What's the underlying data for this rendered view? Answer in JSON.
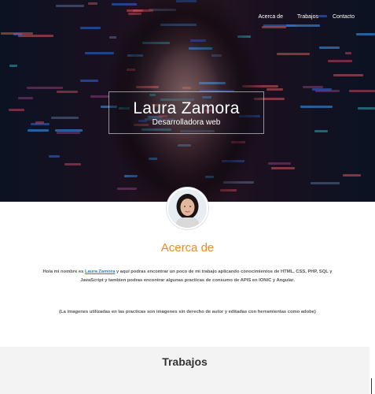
{
  "nav": {
    "items": [
      {
        "label": "Acerca de"
      },
      {
        "label": "Trabajos"
      },
      {
        "label": "Contacto"
      }
    ]
  },
  "hero": {
    "name": "Laura Zamora",
    "role": "Desarrolladora web"
  },
  "about": {
    "title": "Acerca de",
    "intro_prefix": "Hola mi nombre es ",
    "intro_link": "Laura Zamora",
    "intro_suffix": " y aquí podras encontrar un poco de mi trabajo aplicando conocimientos de HTML, CSS, PHP, SQL y JavaScript y tambien podras encontrar algunas practicas de consumo de APIS en IONIC y Angular.",
    "note": "(La imagenes utilizadas en las practicas son imagenes sin derecho de autor y editadas con herramientas como adobe)"
  },
  "jobs": {
    "title": "Trabajos"
  },
  "colors": {
    "accent": "#f08a24",
    "link": "#2a78d6"
  }
}
